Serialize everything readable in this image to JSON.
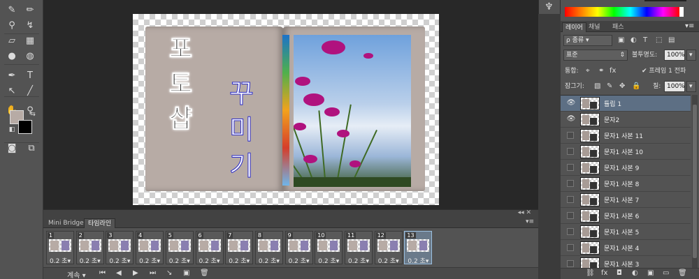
{
  "colors": {
    "ui_bg": "#535353",
    "canvas_bg": "#282828",
    "book_page": "#b7aba5",
    "foreground_swatch": "#b7aba5",
    "background_swatch": "#000000",
    "selected_layer": "#5d6f84",
    "subtitle_outline": "#2b2bc7"
  },
  "tools": [
    {
      "icon": "spot-healing-icon",
      "glyph": "✎"
    },
    {
      "icon": "brush-icon",
      "glyph": "✏"
    },
    {
      "icon": "stamp-icon",
      "glyph": "⚲"
    },
    {
      "icon": "history-brush-icon",
      "glyph": "↯"
    },
    {
      "icon": "eraser-icon",
      "glyph": "▱"
    },
    {
      "icon": "gradient-icon",
      "glyph": "▦"
    },
    {
      "icon": "blur-icon",
      "glyph": "●"
    },
    {
      "icon": "dodge-icon",
      "glyph": "◍"
    },
    {
      "icon": "pen-icon",
      "glyph": "✒"
    },
    {
      "icon": "type-icon",
      "glyph": "T"
    },
    {
      "icon": "path-selection-icon",
      "glyph": "↖"
    },
    {
      "icon": "line-icon",
      "glyph": "╱"
    },
    {
      "icon": "hand-icon",
      "glyph": "✋"
    },
    {
      "icon": "zoom-icon",
      "glyph": "⚲"
    }
  ],
  "artwork": {
    "title_chars": [
      "포",
      "토",
      "샵"
    ],
    "subtitle_chars": [
      "꾸",
      "미",
      "기"
    ]
  },
  "timeline": {
    "tabs": [
      "Mini Bridge",
      "타임라인"
    ],
    "active_tab": 1,
    "frames": [
      {
        "num": "1",
        "delay": "0.2 초▾"
      },
      {
        "num": "2",
        "delay": "0.2 초▾"
      },
      {
        "num": "3",
        "delay": "0.2 초▾"
      },
      {
        "num": "4",
        "delay": "0.2 초▾"
      },
      {
        "num": "5",
        "delay": "0.2 초▾"
      },
      {
        "num": "6",
        "delay": "0.2 초▾"
      },
      {
        "num": "7",
        "delay": "0.2 초▾"
      },
      {
        "num": "8",
        "delay": "0.2 초▾"
      },
      {
        "num": "9",
        "delay": "0.2 초▾"
      },
      {
        "num": "10",
        "delay": "0.2 초▾"
      },
      {
        "num": "11",
        "delay": "0.2 초▾"
      },
      {
        "num": "12",
        "delay": "0.2 초▾"
      },
      {
        "num": "13",
        "delay": "0.2 초▾"
      }
    ],
    "selected_frame": 12,
    "loop_option": "계속",
    "controls": [
      "⏮",
      "◀",
      "▶",
      "⏭"
    ]
  },
  "layers_panel": {
    "tabs": [
      "레이어",
      "채널",
      "패스"
    ],
    "active_tab": 0,
    "filter_label": "ρ 종류",
    "filter_icons": [
      "▣",
      "◐",
      "T",
      "⬚",
      "▤"
    ],
    "blend_mode": "표준",
    "opacity_label": "불투명도:",
    "opacity_value": "100%",
    "unify_label": "통합:",
    "frame_propagate_label": "✔ 프레임 1 전파",
    "lock_label": "잠그기:",
    "fill_label": "칠:",
    "fill_value": "100%",
    "layers": [
      {
        "name": "튤립 1",
        "visible": true
      },
      {
        "name": "문자2",
        "visible": true
      },
      {
        "name": "문자1 사본 11",
        "visible": false
      },
      {
        "name": "문자1 사본 10",
        "visible": false
      },
      {
        "name": "문자1 사본 9",
        "visible": false
      },
      {
        "name": "문자1 사본 8",
        "visible": false
      },
      {
        "name": "문자1 사본 7",
        "visible": false
      },
      {
        "name": "문자1 사본 6",
        "visible": false
      },
      {
        "name": "문자1 사본 5",
        "visible": false
      },
      {
        "name": "문자1 사본 4",
        "visible": false
      },
      {
        "name": "문자1 사본 3",
        "visible": false
      }
    ],
    "selected_layer": 0,
    "bottom_icons": [
      "⛓",
      "fx",
      "◘",
      "◐",
      "▣",
      "▭",
      "🗑"
    ]
  }
}
